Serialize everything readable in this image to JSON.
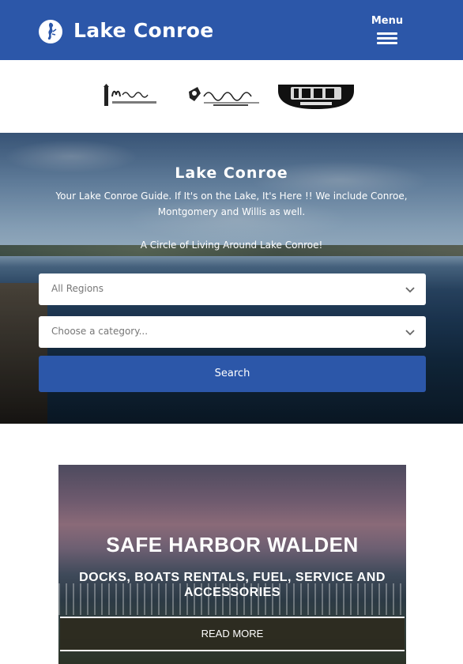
{
  "header": {
    "site_title": "Lake Conroe",
    "menu_label": "Menu",
    "background_color": "#2c57a9"
  },
  "sponsors": [
    {
      "name": "Monty's Lighthouse",
      "icon": "montys-lighthouse-logo"
    },
    {
      "name": "Fajita Jack's",
      "icon": "fajita-jacks-logo"
    },
    {
      "name": "1097 Watersports",
      "icon": "1097-watersports-logo"
    }
  ],
  "hero": {
    "title": "Lake Conroe",
    "description": "Your Lake Conroe Guide. If It's on the Lake, It's Here !! We include Conroe, Montgomery and Willis as well.",
    "tagline": "A Circle of Living Around Lake Conroe!",
    "regions_select": "All Regions",
    "category_placeholder": "Choose a category...",
    "search_label": "Search"
  },
  "promo": {
    "title": "SAFE HARBOR WALDEN",
    "subtitle": "DOCKS, BOATS RENTALS, FUEL, SERVICE AND ACCESSORIES",
    "read_more_label": "READ MORE"
  }
}
